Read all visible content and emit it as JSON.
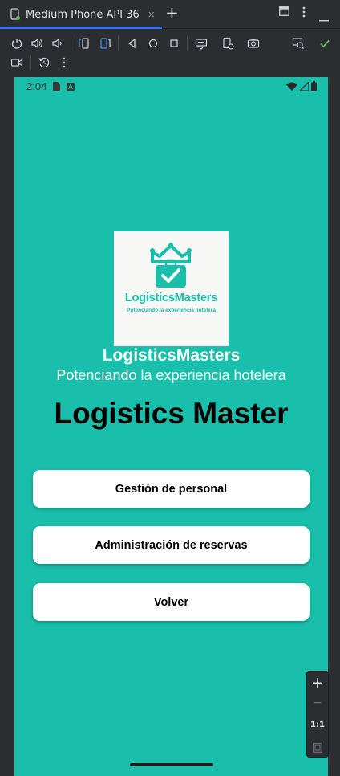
{
  "tabbar": {
    "tab_title": "Medium Phone API 36",
    "close_glyph": "×",
    "add_glyph": "+"
  },
  "statusbar": {
    "time": "2:04"
  },
  "app": {
    "logo_word": "LogisticsMasters",
    "logo_tagline": "Potenciando la experiencia hotelera",
    "brand": "LogisticsMasters",
    "tagline": "Potenciando la experiencia hotelera",
    "title": "Logistics Master",
    "buttons": [
      {
        "label": "Gestión de personal"
      },
      {
        "label": "Administración de reservas"
      },
      {
        "label": "Volver"
      }
    ]
  },
  "zoom": {
    "plus": "+",
    "minus": "−",
    "ratio": "1:1"
  },
  "colors": {
    "accent": "#19bfaa",
    "ide_bg": "#2b2d30",
    "tab_underline": "#3574f0",
    "check_green": "#5fb865"
  }
}
